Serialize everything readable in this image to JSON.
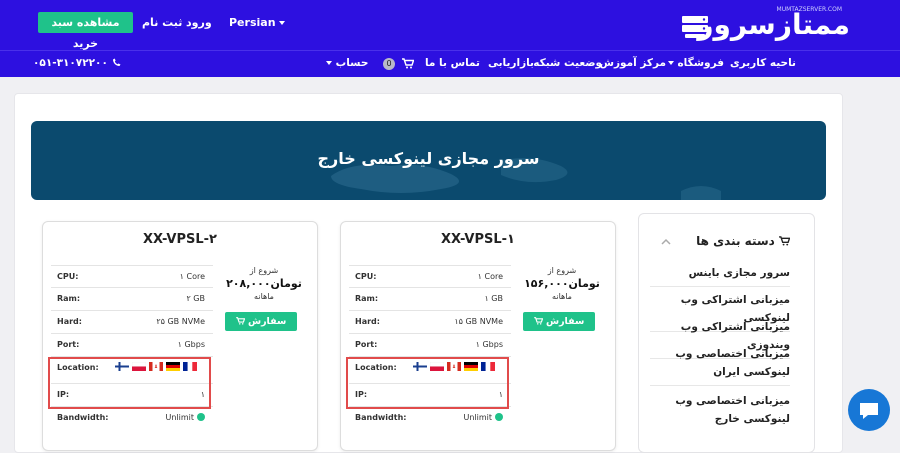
{
  "header": {
    "logo_text": "ممتازسرور",
    "logo_sub": "MUMTAZSERVER.COM",
    "view_cart_label": "مشاهده سبد خرید",
    "register_label": "ثبت نام",
    "login_label": "ورود",
    "language_label": "Persian"
  },
  "nav": {
    "items": [
      "ناحیه کاربری",
      "فروشگاه",
      "مرکز آموزش",
      "وضعیت شبکه",
      "بازاریابی",
      "تماس با ما"
    ],
    "cart_count": "0",
    "account_label": "حساب",
    "phone": "۰۵۱-۳۱۰۷۲۲۰۰"
  },
  "hero": {
    "title": "سرور مجازی لینوکسی خارج"
  },
  "plans": [
    {
      "name": "XX-VPSL-۲",
      "price_from": "شروع از",
      "price": "۲۰۸,۰۰۰تومان",
      "period": "ماهانه",
      "order_label": "سفارش دهید",
      "specs": [
        {
          "k": "CPU:",
          "v": "۱ Core"
        },
        {
          "k": "Ram:",
          "v": "۲ GB"
        },
        {
          "k": "Hard:",
          "v": "۲۵ GB NVMe"
        },
        {
          "k": "Port:",
          "v": "۱ Gbps"
        },
        {
          "k": "Location:",
          "v": ""
        },
        {
          "k": "IP:",
          "v": "۱"
        },
        {
          "k": "Bandwidth:",
          "v": "Unlimit"
        }
      ]
    },
    {
      "name": "XX-VPSL-۱",
      "price_from": "شروع از",
      "price": "۱۵۶,۰۰۰تومان",
      "period": "ماهانه",
      "order_label": "سفارش دهید",
      "specs": [
        {
          "k": "CPU:",
          "v": "۱ Core"
        },
        {
          "k": "Ram:",
          "v": "۱ GB"
        },
        {
          "k": "Hard:",
          "v": "۱۵ GB NVMe"
        },
        {
          "k": "Port:",
          "v": "۱ Gbps"
        },
        {
          "k": "Location:",
          "v": ""
        },
        {
          "k": "IP:",
          "v": "۱"
        },
        {
          "k": "Bandwidth:",
          "v": "Unlimit"
        }
      ]
    }
  ],
  "sidebar": {
    "title": "دسته بندی ها",
    "items": [
      "سرور مجازی باینس",
      "میزبانی اشتراکی وب لینوکسی",
      "میزبانی اشتراکی وب ویندوزی",
      "میزبانی اختصاصی وب لینوکسی ایران",
      "میزبانی اختصاصی وب لینوکسی خارج"
    ]
  },
  "colors": {
    "brand": "#2d10e0",
    "accent": "#1fc28a",
    "hero": "#0b4a6e",
    "highlight": "#e14b4b"
  }
}
